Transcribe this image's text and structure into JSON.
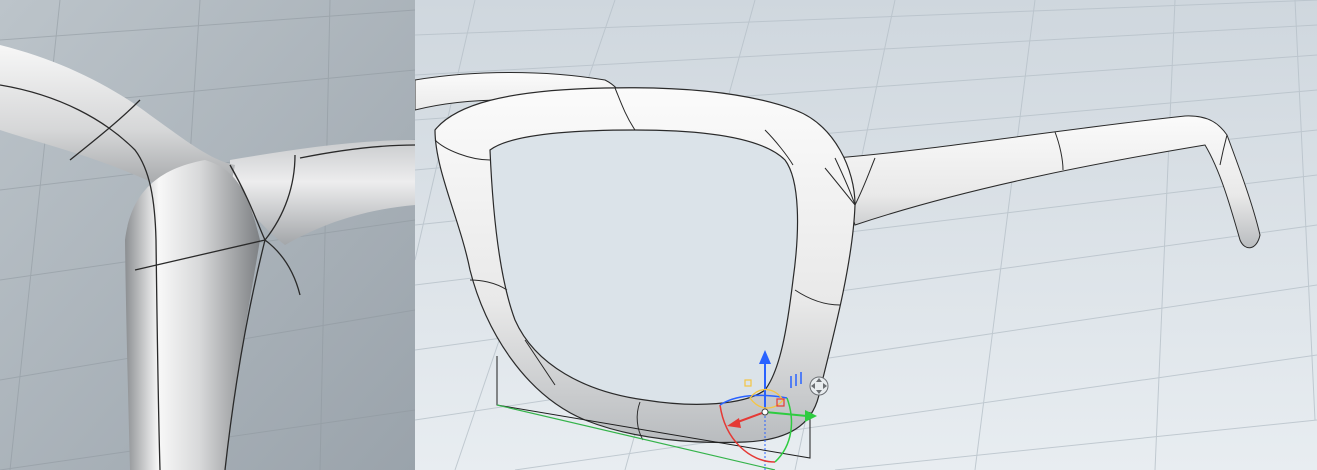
{
  "app": {
    "name": ""
  },
  "viewports": [
    {
      "id": "detail",
      "content": "zoomed-frame-joint"
    },
    {
      "id": "perspective",
      "content": "glasses-frame-model"
    }
  ],
  "gizmo": {
    "icons": [
      "move-arrow-up-icon",
      "move-arrow-right-icon",
      "rotate-arc-icon",
      "scale-handle-icon",
      "pan-cursor-icon"
    ],
    "colors": {
      "x": "#e53935",
      "y": "#2ecc40",
      "z": "#2962ff",
      "rotate": "#f5c542"
    }
  },
  "colors": {
    "grid_background_left": "#aeb7bf",
    "grid_background_right": "#dfe6ec",
    "model_surface": "#f2f2f2",
    "edge_lines": "#2a2a2a",
    "bounding_box": "#1e1e1e",
    "axis_line_green": "#34b34a"
  }
}
